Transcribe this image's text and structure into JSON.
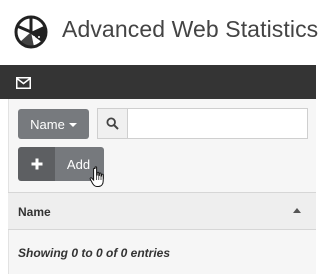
{
  "app": {
    "title": "Advanced Web Statistics"
  },
  "nav": {
    "icons": [
      "mail-icon"
    ]
  },
  "toolbar": {
    "filter_label": "Name",
    "search_value": "",
    "add_label": "Add"
  },
  "table": {
    "columns": [
      "Name"
    ],
    "info": "Showing 0 to 0 of 0 entries"
  },
  "colors": {
    "nav_bg": "#343434",
    "button_gray": "#777a7e",
    "button_dark": "#5d5f62",
    "panel_bg": "#f6f6f6",
    "header_bg": "#eeeeee"
  }
}
